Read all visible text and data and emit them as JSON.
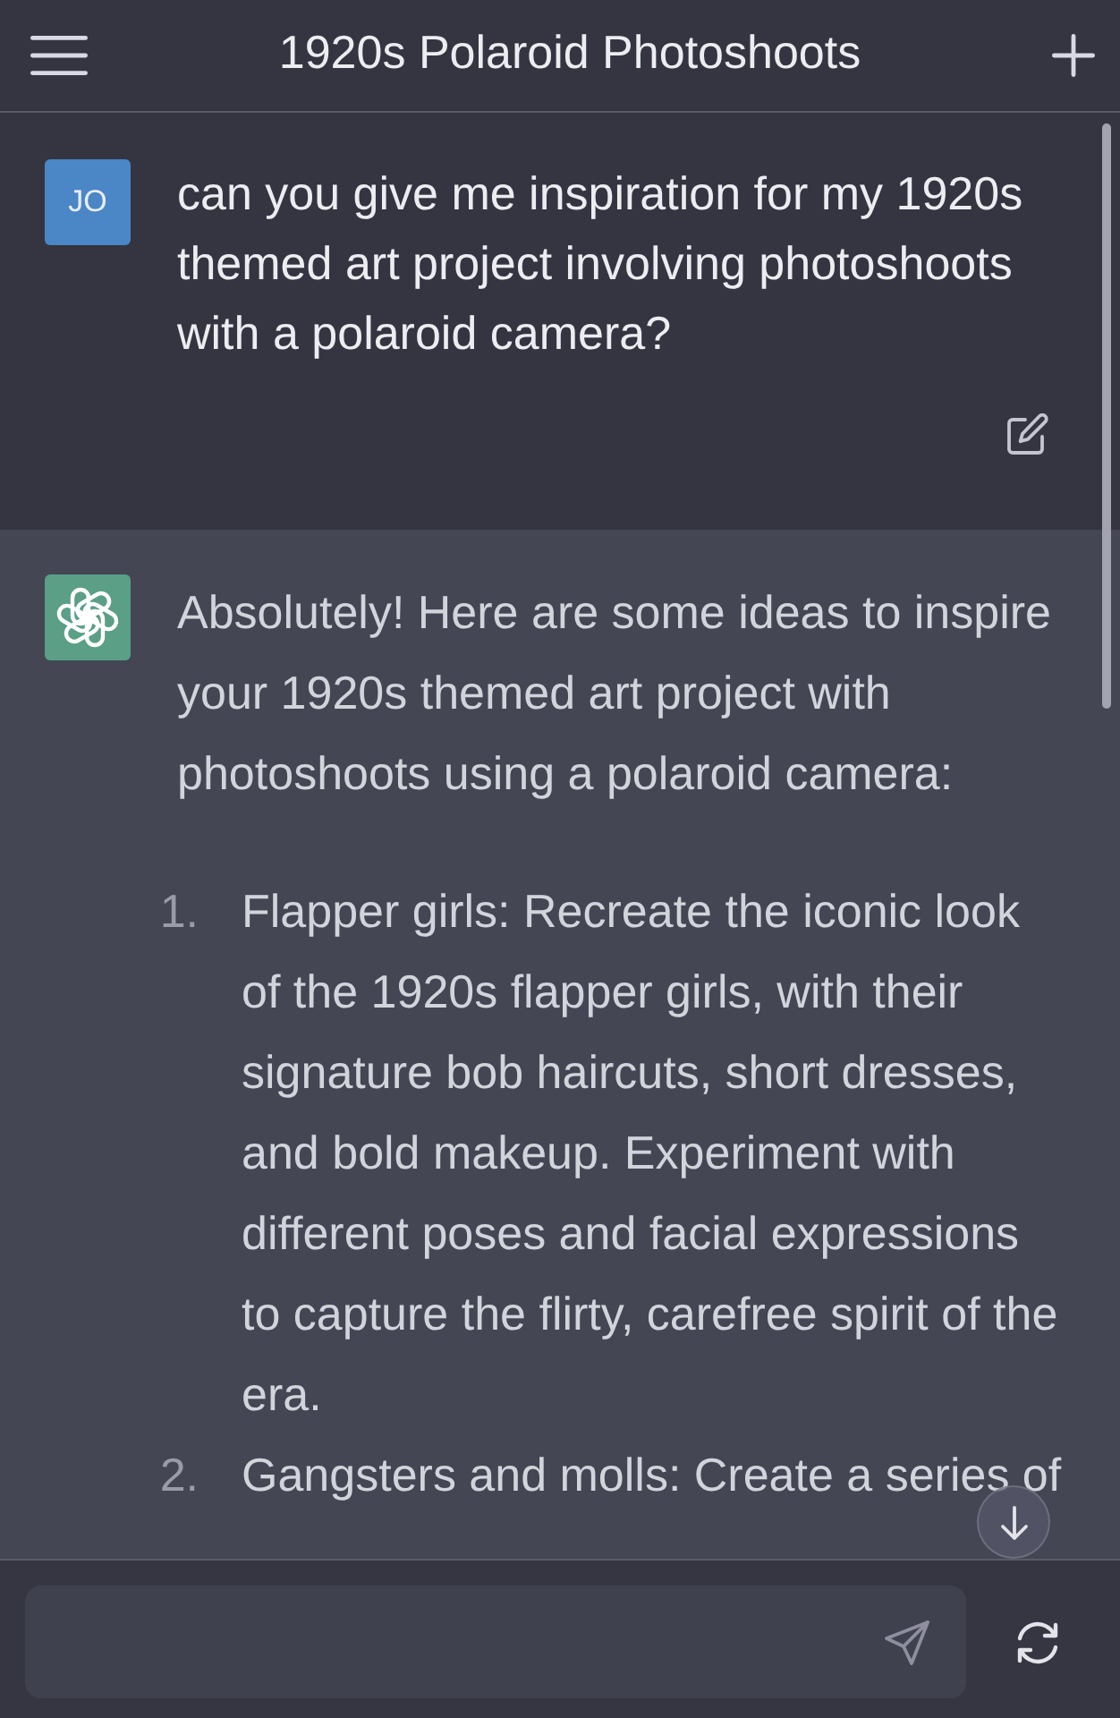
{
  "header": {
    "title": "1920s Polaroid Photoshoots"
  },
  "messages": [
    {
      "kind": "user",
      "avatar": "JO",
      "text": "can you give me inspiration for my 1920s themed art project involving photoshoots with a polaroid camera?"
    },
    {
      "kind": "assistant",
      "text": "Absolutely! Here are some ideas to inspire your 1920s themed art project with photoshoots using a polaroid camera:",
      "list": [
        {
          "number": "1.",
          "text": "Flapper girls: Recreate the iconic look of the 1920s flapper girls, with their signature bob haircuts, short dresses, and bold makeup. Experiment with different poses and facial expressions to capture the flirty, carefree spirit of the era."
        },
        {
          "number": "2.",
          "text": "Gangsters and molls: Create a series of"
        }
      ]
    }
  ]
}
